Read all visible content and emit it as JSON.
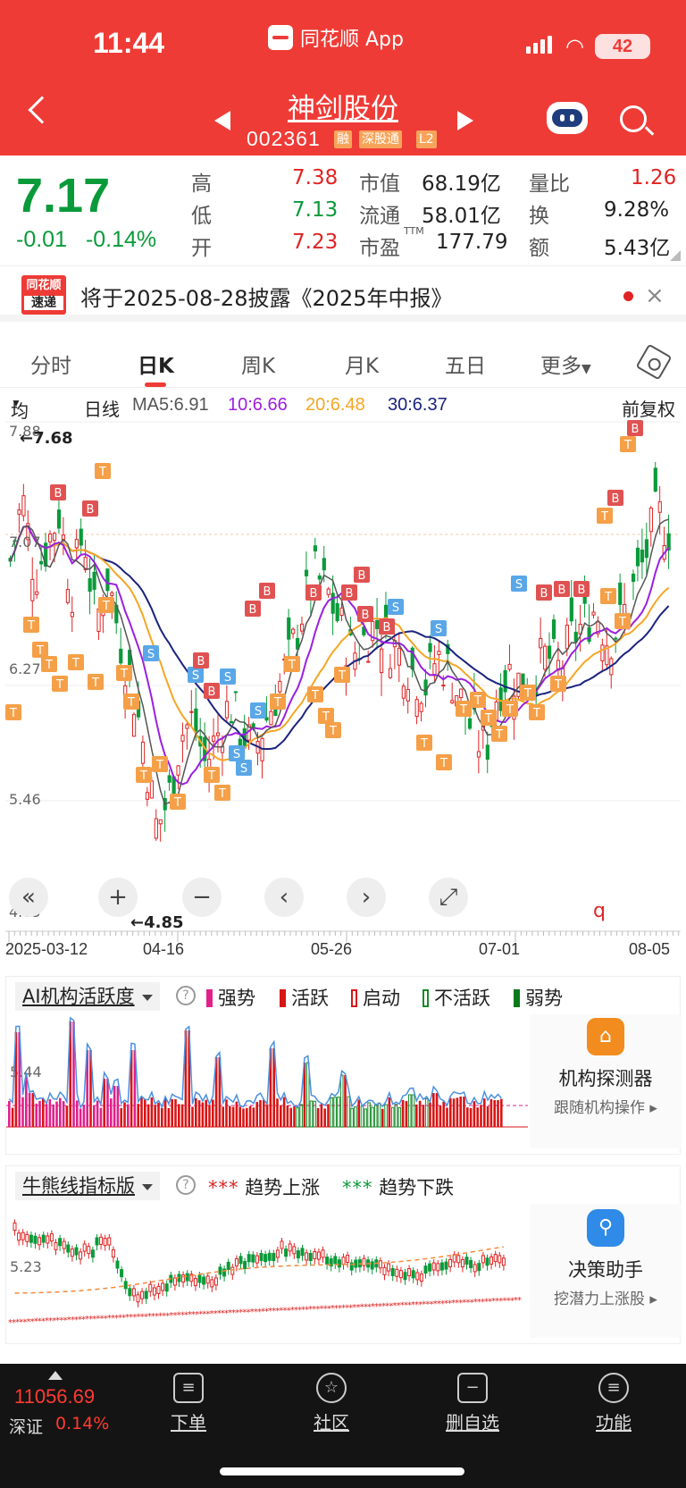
{
  "status": {
    "time": "11:44",
    "app": "同花顺 App",
    "battery": "42"
  },
  "stock": {
    "name": "神剑股份",
    "code": "002361",
    "tags": [
      "融",
      "深股通",
      "L2"
    ]
  },
  "quote": {
    "price": "7.17",
    "change": "-0.01",
    "change_pct": "-0.14%",
    "high_label": "高",
    "high": "7.38",
    "low_label": "低",
    "low": "7.13",
    "open_label": "开",
    "open": "7.23",
    "mcap_label": "市值",
    "mcap": "68.19亿",
    "float_label": "流通",
    "float": "58.01亿",
    "pe_label": "市盈",
    "pe_sup": "TTM",
    "pe": "177.79",
    "vr_label": "量比",
    "vr": "1.26",
    "turnover_label": "换",
    "turnover": "9.28%",
    "amount_label": "额",
    "amount": "5.43亿"
  },
  "notice": {
    "logo_top": "同花顺",
    "logo_bottom": "速递",
    "text": "将于2025-08-28披露《2025年中报》",
    "close": "×"
  },
  "tabs": [
    "分时",
    "日K",
    "周K",
    "月K",
    "五日",
    "更多"
  ],
  "ma": {
    "selector": "均线",
    "period": "日线",
    "ma5": "MA5:6.91",
    "ma10": "10:6.66",
    "ma20": "20:6.48",
    "ma30": "30:6.37",
    "adjust": "前复权"
  },
  "kchart": {
    "y_ticks": [
      "7.88",
      "7.07",
      "6.27",
      "5.46",
      "4.65"
    ],
    "high_marker": "←7.68",
    "low_marker": "←4.85",
    "dates": [
      "2025-03-12",
      "04-16",
      "05-26",
      "07-01",
      "08-05"
    ],
    "controls": [
      "«",
      "+",
      "−",
      "‹",
      "›",
      "⤢"
    ]
  },
  "ai_panel": {
    "title": "AI机构活跃度",
    "help": "?",
    "legend": [
      "强势",
      "活跃",
      "启动",
      "不活跃",
      "弱势"
    ],
    "y_tick": "5.44",
    "card_title": "机构探测器",
    "card_sub": "跟随机构操作 ▸"
  },
  "bull_panel": {
    "title": "牛熊线指标版",
    "help": "?",
    "legend_up": "趋势上涨",
    "legend_down": "趋势下跌",
    "y_tick": "5.23",
    "card_title": "决策助手",
    "card_sub": "挖潜力上涨股 ▸"
  },
  "bottom": {
    "index_value": "11056.69",
    "index_name": "深证",
    "index_change": "0.14%",
    "nav": [
      "下单",
      "社区",
      "删自选",
      "功能"
    ]
  },
  "colors": {
    "brand": "#ef3b36",
    "up": "#e02424",
    "down": "#0a9a3a",
    "ma5": "#555555",
    "ma10": "#9b1fe0",
    "ma20": "#f5a623",
    "ma30": "#1a237e"
  }
}
